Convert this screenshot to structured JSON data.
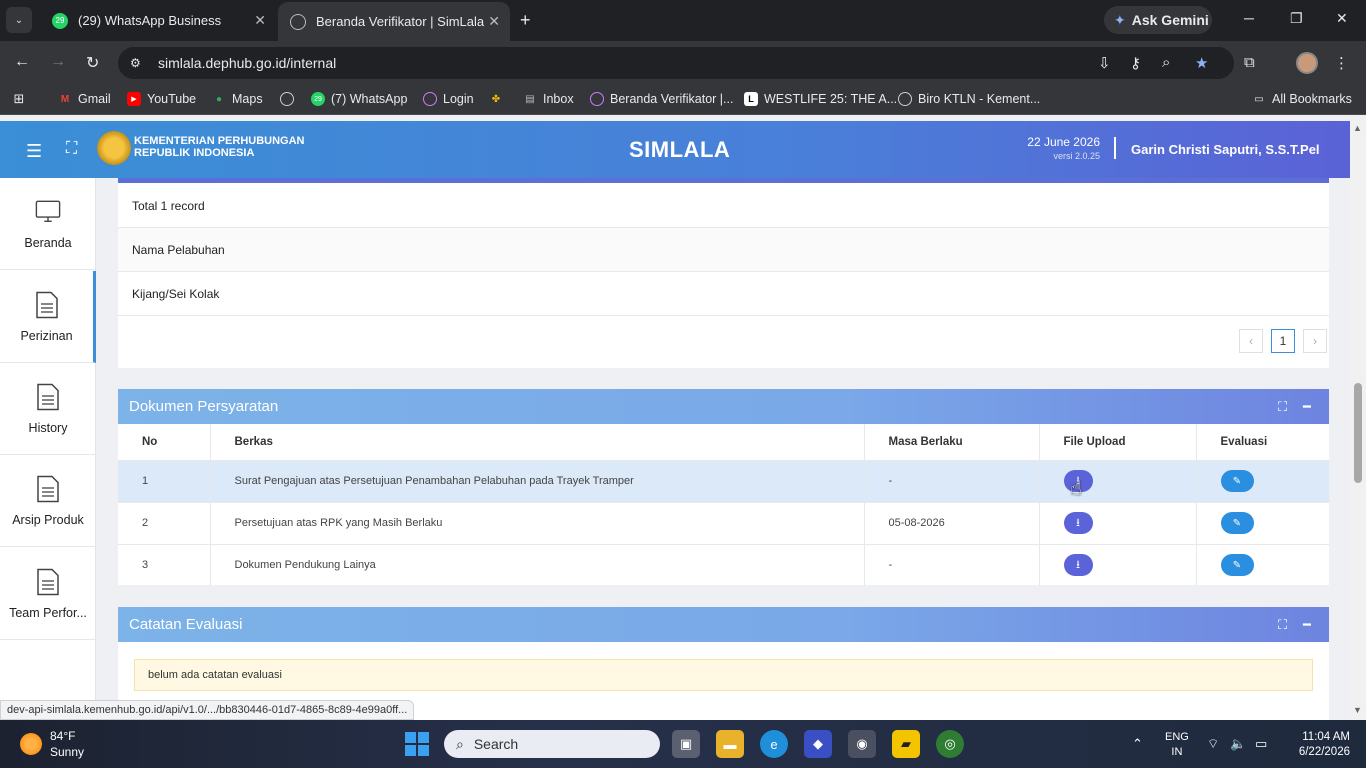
{
  "browser": {
    "tabs": [
      {
        "title": "(29) WhatsApp Business",
        "badge": "29"
      },
      {
        "title": "Beranda Verifikator | SimLala"
      }
    ],
    "gemini_label": "Ask Gemini",
    "url": "simlala.dephub.go.id/internal",
    "bookmarks": [
      "Gmail",
      "YouTube",
      "Maps",
      "(7) WhatsApp",
      "Login",
      "Inbox",
      "Beranda Verifikator |...",
      "WESTLIFE 25: THE A...",
      "Biro KTLN - Kement..."
    ],
    "bookmark_badge": "29",
    "all_bookmarks": "All Bookmarks",
    "status_url": "dev-api-simlala.kemenhub.go.id/api/v1.0/.../bb830446-01d7-4865-8c89-4e99a0ff..."
  },
  "app": {
    "ministry_line1": "KEMENTERIAN PERHUBUNGAN",
    "ministry_line2": "REPUBLIK INDONESIA",
    "name": "SIMLALA",
    "date": "22 June 2026",
    "version": "versi 2.0.25",
    "user": "Garin Christi Saputri, S.S.T.Pel"
  },
  "sidebar": {
    "items": [
      {
        "label": "Beranda",
        "icon": "monitor-icon"
      },
      {
        "label": "Perizinan",
        "icon": "document-icon"
      },
      {
        "label": "History",
        "icon": "document-icon"
      },
      {
        "label": "Arsip Produk",
        "icon": "document-icon"
      },
      {
        "label": "Team Perfor...",
        "icon": "document-icon"
      }
    ]
  },
  "ports": {
    "total": "Total 1 record",
    "header": "Nama Pelabuhan",
    "value": "Kijang/Sei Kolak",
    "page": "1",
    "prev": "‹",
    "next": "›"
  },
  "documents": {
    "title": "Dokumen Persyaratan",
    "columns": [
      "No",
      "Berkas",
      "Masa Berlaku",
      "File Upload",
      "Evaluasi"
    ],
    "rows": [
      {
        "no": "1",
        "berkas": "Surat Pengajuan atas Persetujuan Penambahan Pelabuhan pada Trayek Tramper",
        "masa": "-"
      },
      {
        "no": "2",
        "berkas": "Persetujuan atas RPK yang Masih Berlaku",
        "masa": "05-08-2026"
      },
      {
        "no": "3",
        "berkas": "Dokumen Pendukung Lainya",
        "masa": "-"
      }
    ]
  },
  "evaluation": {
    "title": "Catatan Evaluasi",
    "empty": "belum ada catatan evaluasi"
  },
  "taskbar": {
    "temp": "84°F",
    "condition": "Sunny",
    "search": "Search",
    "lang1": "ENG",
    "lang2": "IN",
    "time": "11:04 AM",
    "date": "6/22/2026"
  }
}
